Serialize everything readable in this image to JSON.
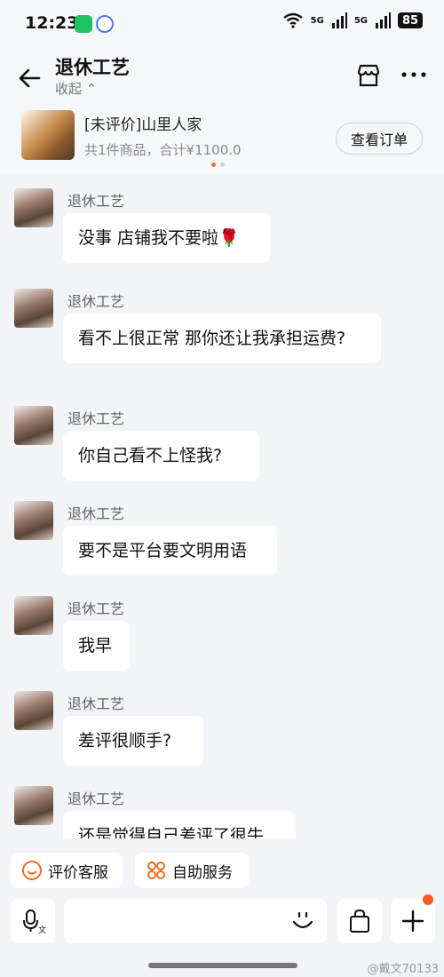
{
  "status_bar": {
    "time": "12:23",
    "signal1": "5G",
    "signal2": "5G",
    "battery": "85",
    "app_icons": [
      "wechat-icon",
      "browser-icon"
    ]
  },
  "header": {
    "title": "退休工艺",
    "collapse_label": "收起",
    "icons": [
      "back-arrow-icon",
      "shop-icon",
      "more-icon"
    ]
  },
  "order_card": {
    "title": "[未评价]山里人家",
    "summary": "共1件商品，合计¥1100.0",
    "button_label": "查看订单"
  },
  "messages": [
    {
      "sender": "退休工艺",
      "text": "没事 店铺我不要啦🌹"
    },
    {
      "sender": "退休工艺",
      "text": "看不上很正常 那你还让我承担运费?"
    },
    {
      "sender": "退休工艺",
      "text": "你自己看不上怪我?"
    },
    {
      "sender": "退休工艺",
      "text": "要不是平台要文明用语"
    },
    {
      "sender": "退休工艺",
      "text": "我早"
    },
    {
      "sender": "退休工艺",
      "text": "差评很顺手?"
    },
    {
      "sender": "退休工艺",
      "text": "还是觉得自己差评了很牛"
    }
  ],
  "quick_actions": {
    "eval_service": "评价客服",
    "self_service": "自助服务"
  },
  "input": {
    "placeholder": ""
  },
  "watermark": "@戴文70133",
  "colors": {
    "accent_orange": "#f26c1b",
    "background": "#f3f4f7",
    "bubble": "#ffffff"
  }
}
